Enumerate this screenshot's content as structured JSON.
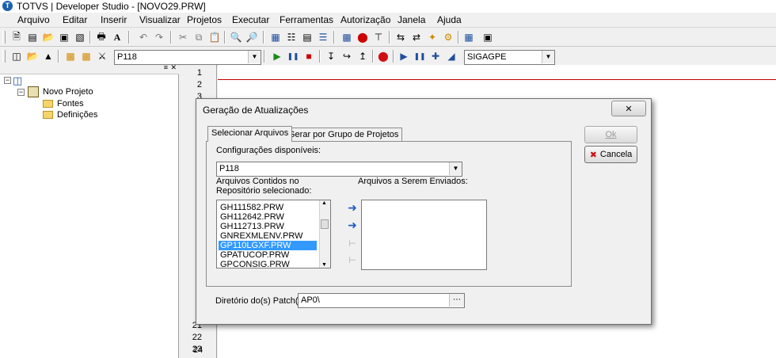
{
  "window": {
    "title": "TOTVS | Developer Studio - [NOVO29.PRW]"
  },
  "menu": [
    {
      "label": "Arquivo"
    },
    {
      "label": "Editar"
    },
    {
      "label": "Inserir"
    },
    {
      "label": "Visualizar"
    },
    {
      "label": "Projetos"
    },
    {
      "label": "Executar"
    },
    {
      "label": "Ferramentas"
    },
    {
      "label": "Autorização"
    },
    {
      "label": "Janela"
    },
    {
      "label": "Ajuda"
    }
  ],
  "toolbar2": {
    "environment": "P118",
    "environment2": "SIGAGPE"
  },
  "project_tree": {
    "root": "Novo Projeto",
    "folders": [
      "Fontes",
      "Definições"
    ]
  },
  "editor": {
    "line_numbers": [
      "1",
      "2",
      "3",
      "21",
      "22",
      "23",
      "24"
    ]
  },
  "dialog": {
    "title": "Geração de Atualizações",
    "tabs": [
      "Selecionar Arquivos",
      "Gerar por Grupo de Projetos"
    ],
    "config_label": "Configurações disponíveis:",
    "config_value": "P118",
    "repo_label_1": "Arquivos Contidos no",
    "repo_label_2": "Repositório selecionado:",
    "send_label": "Arquivos a Serem Enviados:",
    "repo_files": [
      "GH111582.PRW",
      "GH112642.PRW",
      "GH112713.PRW",
      "GNREXMLENV.PRW",
      "GP110LGXF.PRW",
      "GPATUCOP.PRW",
      "GPCONSIG.PRW"
    ],
    "selected_file": "GP110LGXF.PRW",
    "patch_dir_label": "Diretório do(s) Patch(s):",
    "patch_dir_value": "AP0\\",
    "ok_label": "Ok",
    "cancel_label": "Cancela"
  }
}
